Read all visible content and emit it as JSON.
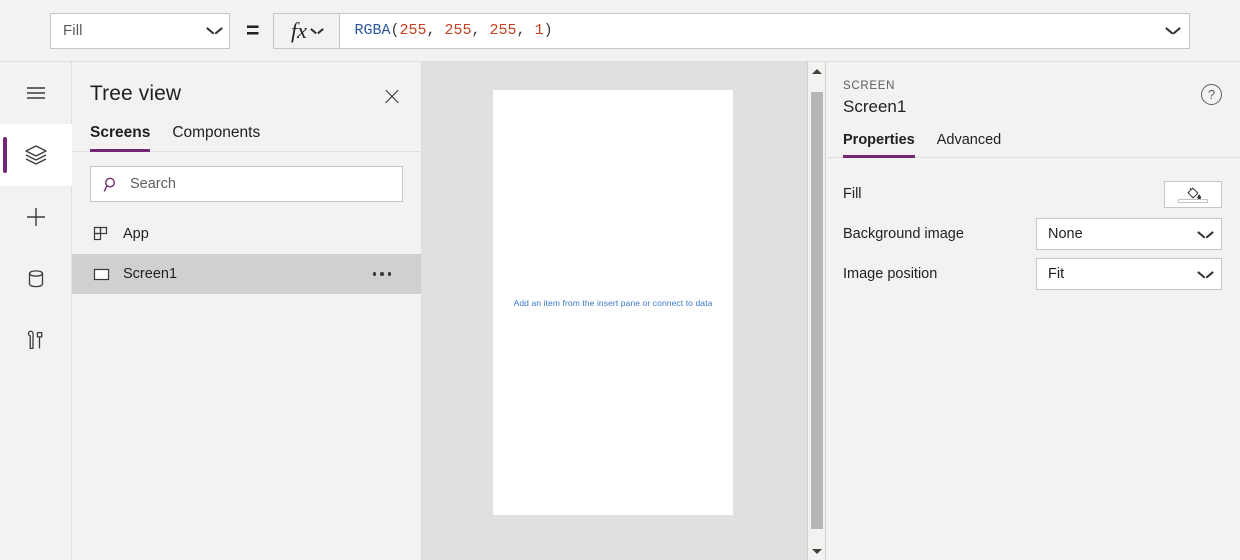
{
  "formula_bar": {
    "property_select": {
      "value": "Fill",
      "chevron_icon": "chevron-down-icon"
    },
    "equals": "=",
    "fx_label": "fx",
    "formula": {
      "function_name": "RGBA",
      "open_paren": "(",
      "args": [
        "255",
        "255",
        "255",
        "1"
      ],
      "separator": ", ",
      "close_paren": ")",
      "full_text": "RGBA(255, 255, 255, 1)"
    }
  },
  "rail": {
    "items": [
      {
        "name": "menu",
        "icon": "hamburger-menu-icon",
        "selected": false
      },
      {
        "name": "tree-view",
        "icon": "layers-icon",
        "selected": true
      },
      {
        "name": "insert",
        "icon": "plus-icon",
        "selected": false
      },
      {
        "name": "data",
        "icon": "database-icon",
        "selected": false
      },
      {
        "name": "advanced",
        "icon": "tools-icon",
        "selected": false
      }
    ]
  },
  "tree_view": {
    "title": "Tree view",
    "close_icon": "close-icon",
    "tabs": [
      {
        "label": "Screens",
        "active": true
      },
      {
        "label": "Components",
        "active": false
      }
    ],
    "search": {
      "placeholder": "Search",
      "value": "",
      "icon": "search-icon"
    },
    "items": [
      {
        "label": "App",
        "icon": "app-grid-icon",
        "selected": false,
        "has_menu": false
      },
      {
        "label": "Screen1",
        "icon": "screen-rect-icon",
        "selected": true,
        "has_menu": true
      }
    ],
    "overflow_menu_icon": "ellipsis-icon"
  },
  "canvas": {
    "hint_text": "Add an item from the insert pane or connect to data",
    "hint_color": "#3a78c9",
    "screen_background": "#ffffff",
    "backdrop_color": "#e0e0e0",
    "scrollbar": {
      "up_icon": "scroll-up-arrow-icon",
      "down_icon": "scroll-down-arrow-icon"
    }
  },
  "properties_panel": {
    "kicker": "SCREEN",
    "name": "Screen1",
    "help_icon": "help-circle-icon",
    "help_glyph": "?",
    "tabs": [
      {
        "label": "Properties",
        "active": true
      },
      {
        "label": "Advanced",
        "active": false
      }
    ],
    "rows": [
      {
        "label": "Fill",
        "control": "color",
        "icon": "paint-bucket-icon",
        "swatch": "#ffffff"
      },
      {
        "label": "Background image",
        "control": "dropdown",
        "value": "None"
      },
      {
        "label": "Image position",
        "control": "dropdown",
        "value": "Fit"
      }
    ]
  },
  "theme": {
    "accent": "#742774",
    "panel_bg": "#f3f2f1",
    "border": "#c8c6c4",
    "selected_row": "#d2d0ce",
    "text": "#201f1e",
    "muted_text": "#605e5c"
  }
}
